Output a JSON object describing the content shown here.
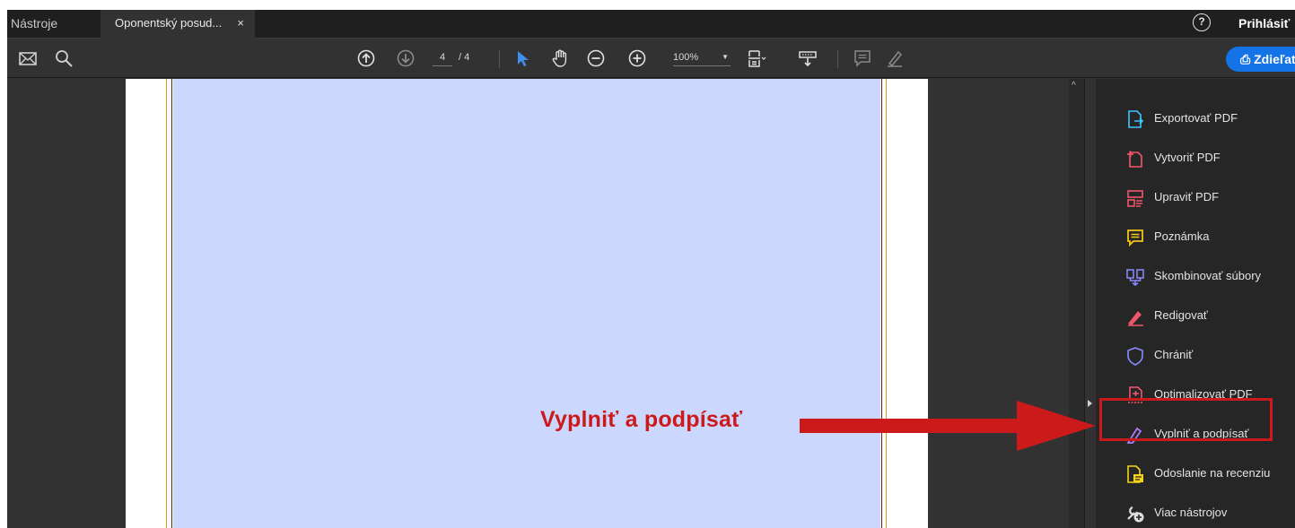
{
  "tabs": {
    "tools_label": "Nástroje",
    "doc_label": "Oponentský posud...",
    "close_glyph": "×",
    "help_glyph": "?",
    "signin_label": "Prihlásiť"
  },
  "toolbar": {
    "page_current": "4",
    "page_total": "/ 4",
    "zoom_value": "100%",
    "zoom_caret": "▼",
    "share_label": "Zdieľať",
    "icons": [
      "mail-icon",
      "search-icon",
      "page-up-icon",
      "page-down-icon",
      "select-cursor-icon",
      "hand-icon",
      "zoom-out-icon",
      "zoom-in-icon",
      "fit-page-icon",
      "scroll-mode-icon",
      "comment-icon",
      "pen-icon"
    ]
  },
  "scrollbar": {
    "up_glyph": "^"
  },
  "panel": {
    "items": [
      {
        "label": "Exportovať PDF",
        "icon": "export-pdf-icon",
        "color": "#3ec6ff"
      },
      {
        "label": "Vytvoriť PDF",
        "icon": "create-pdf-icon",
        "color": "#f2566b"
      },
      {
        "label": "Upraviť PDF",
        "icon": "edit-pdf-icon",
        "color": "#f2566b"
      },
      {
        "label": "Poznámka",
        "icon": "comment-icon",
        "color": "#f5c518"
      },
      {
        "label": "Skombinovať súbory",
        "icon": "combine-files-icon",
        "color": "#8b8bff"
      },
      {
        "label": "Redigovať",
        "icon": "redact-icon",
        "color": "#f2566b"
      },
      {
        "label": "Chrániť",
        "icon": "protect-icon",
        "color": "#8b8bff"
      },
      {
        "label": "Optimalizovať PDF",
        "icon": "optimize-pdf-icon",
        "color": "#f2566b"
      },
      {
        "label": "Vyplniť a podpísať",
        "icon": "fill-sign-icon",
        "color": "#b07cff"
      },
      {
        "label": "Odoslanie na recenziu",
        "icon": "send-review-icon",
        "color": "#f5d418"
      },
      {
        "label": "Viac nástrojov",
        "icon": "more-tools-icon",
        "color": "#dddddd"
      }
    ]
  },
  "annotation": {
    "callout_text": "Vyplniť a podpísať",
    "color": "#cc1a1a"
  },
  "colors": {
    "page_fill": "#ccd7fe",
    "share_blue": "#1473e6"
  }
}
